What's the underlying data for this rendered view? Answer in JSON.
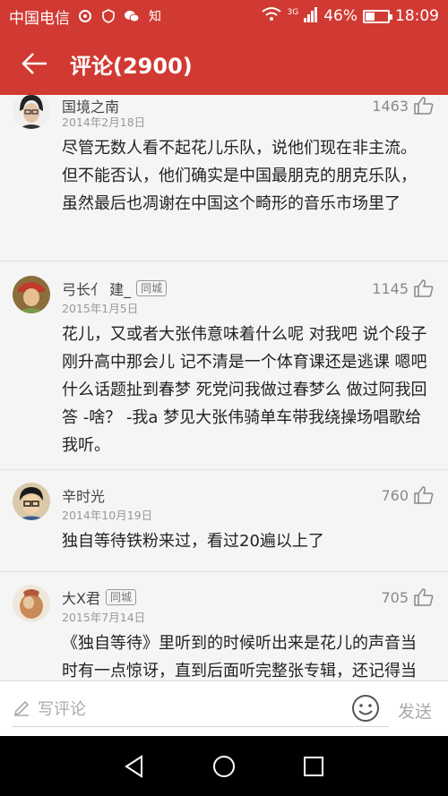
{
  "status_bar": {
    "carrier": "中国电信",
    "app_label": "知",
    "network": "3G",
    "battery": "46%",
    "battery_level": 0.46,
    "time": "18:09"
  },
  "header": {
    "title": "评论(2900)"
  },
  "comments": [
    {
      "name": "国境之南",
      "badge": "",
      "date": "2014年2月18日",
      "likes": "1463",
      "text": "尽管无数人看不起花儿乐队，说他们现在非主流。但不能否认，他们确实是中国最朋克的朋克乐队，虽然最后也凋谢在中国这个畸形的音乐市场里了"
    },
    {
      "name": "弓长亻 建_",
      "badge": "同城",
      "date": "2015年1月5日",
      "likes": "1145",
      "text": "花儿，又或者大张伟意味着什么呢 对我吧 说个段子 刚升高中那会儿 记不清是一个体育课还是逃课 嗯吧什么话题扯到春梦 死党问我做过春梦么 做过阿我回答 -啥？ -我a 梦见大张伟骑单车带我绕操场唱歌给我听。"
    },
    {
      "name": "辛时光",
      "badge": "",
      "date": "2014年10月19日",
      "likes": "760",
      "text": "独自等待铁粉来过，看过20遍以上了"
    },
    {
      "name": "大X君",
      "badge": "同城",
      "date": "2015年7月14日",
      "likes": "705",
      "text": "《独自等待》里听到的时候听出来是花儿的声音当时有一点惊讶，直到后面听完整张专辑，还记得当时等文打替录音机在刘学楼下大声点"
    }
  ],
  "compose": {
    "placeholder": "写评论",
    "send_label": "发送"
  },
  "colors": {
    "brand_red": "#d03a33",
    "background": "#f5f5f5"
  }
}
